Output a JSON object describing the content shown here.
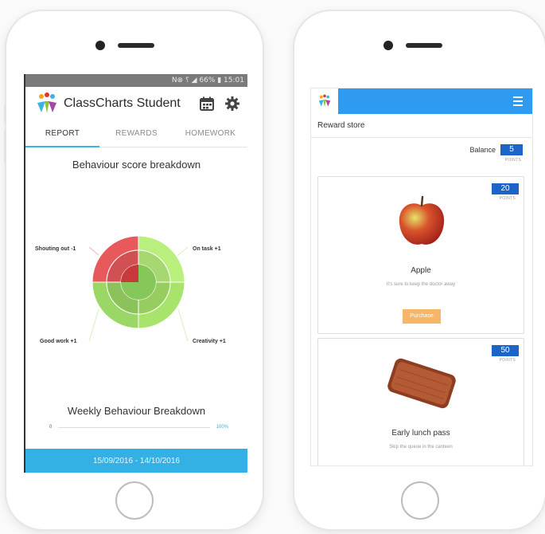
{
  "left_phone": {
    "status_bar": "N⊗ ⸮ ◢ 66% ▮ 15:01",
    "app_title": "ClassCharts Student",
    "tabs": [
      {
        "label": "REPORT",
        "active": true
      },
      {
        "label": "REWARDS",
        "active": false
      },
      {
        "label": "HOMEWORK",
        "active": false
      }
    ],
    "behaviour_title": "Behaviour score breakdown",
    "chart_data": {
      "type": "pie",
      "title": "Behaviour score breakdown",
      "slices": [
        {
          "label": "Shouting out -1",
          "value": -1,
          "color": "#e8595c"
        },
        {
          "label": "On task +1",
          "value": 1,
          "color": "#b9ef7d"
        },
        {
          "label": "Creativity +1",
          "value": 1,
          "color": "#a8e36c"
        },
        {
          "label": "Good work +1",
          "value": 1,
          "color": "#9ad764"
        }
      ]
    },
    "weekly_title": "Weekly Behaviour Breakdown",
    "progress_start": "0",
    "progress_end": "100%",
    "date_range": "15/09/2016 - 14/10/2016"
  },
  "right_phone": {
    "store_title": "Reward store",
    "balance_label": "Balance",
    "balance_value": "5",
    "points_unit": "POINTS",
    "rewards": [
      {
        "cost": "20",
        "name": "Apple",
        "description": "It's sure to keep the doctor away",
        "button": "Purchase"
      },
      {
        "cost": "50",
        "name": "Early lunch pass",
        "description": "Skip the queue in the canteen"
      }
    ]
  },
  "colors": {
    "accent_blue": "#33b0e4",
    "header_blue": "#2f9bf0",
    "badge_blue": "#1d64c9",
    "negative_red": "#e8595c",
    "positive_green": "#a8e36c",
    "purchase_orange": "#f7b56a"
  },
  "icons": [
    "classcharts-logo-icon",
    "calendar-icon",
    "gear-icon",
    "hamburger-menu-icon",
    "apple-image",
    "tray-image"
  ]
}
